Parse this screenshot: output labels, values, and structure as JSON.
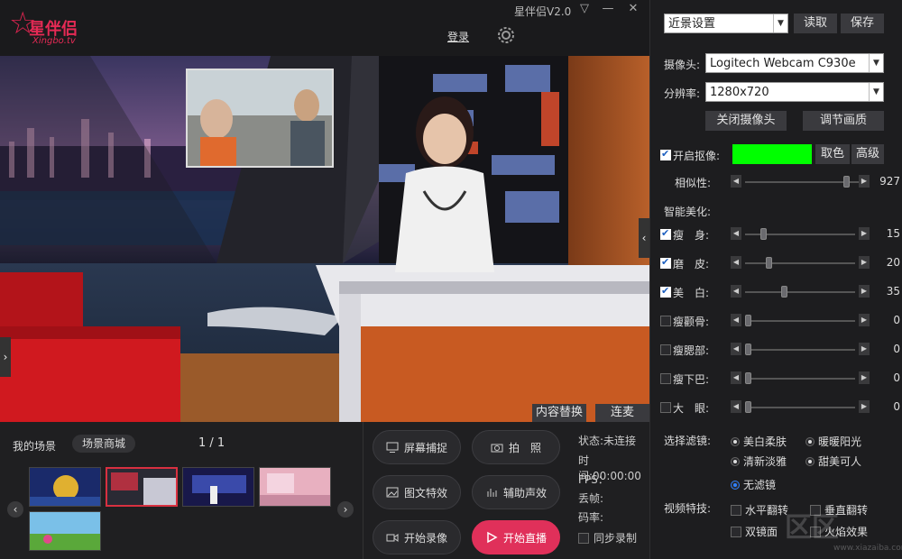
{
  "app": {
    "title": "星伴侣V2.0",
    "logo_text": "星伴侣",
    "logo_sub": "Xingbo.tv",
    "login": "登录"
  },
  "window": {
    "minimize": "▽",
    "maximize": "—",
    "close": "✕"
  },
  "preview": {
    "content_replace": "内容替换",
    "co_host": "连麦"
  },
  "scenes": {
    "my_scenes": "我的场景",
    "scene_mall": "场景商城",
    "page": "1 / 1"
  },
  "actions": {
    "screen_capture": "屏幕捕捉",
    "photo": "拍　照",
    "graphic_fx": "图文特效",
    "aux_sound": "辅助声效",
    "start_record": "开始录像",
    "start_live": "开始直播"
  },
  "status": {
    "state": "状态:未连接",
    "time": "时间:00:00:00",
    "fps": "FPS：",
    "drop": "丢帧:",
    "bitrate": "码率:",
    "sync_record": "同步录制"
  },
  "panel": {
    "preset": "近景设置",
    "read": "读取",
    "save": "保存",
    "camera_label": "摄像头:",
    "camera": "Logitech Webcam C930e",
    "resolution_label": "分辨率:",
    "resolution": "1280x720",
    "close_camera": "关闭摄像头",
    "adjust_image": "调节画质",
    "keying": "开启抠像:",
    "pick_color": "取色",
    "advanced": "高级",
    "key_color": "#00ff00",
    "similarity": {
      "label": "相似性:",
      "value": 927,
      "fraction": 0.92
    },
    "beauty_title": "智能美化:",
    "beauty": [
      {
        "label": "瘦　身:",
        "checked": true,
        "value": "15",
        "fraction": 0.15
      },
      {
        "label": "磨　皮:",
        "checked": true,
        "value": "20",
        "fraction": 0.2
      },
      {
        "label": "美　白:",
        "checked": true,
        "value": "35",
        "fraction": 0.35
      },
      {
        "label": "瘦颧骨:",
        "checked": false,
        "value": "0",
        "fraction": 0
      },
      {
        "label": "瘦腮部:",
        "checked": false,
        "value": "0",
        "fraction": 0
      },
      {
        "label": "瘦下巴:",
        "checked": false,
        "value": "0",
        "fraction": 0
      },
      {
        "label": "大　眼:",
        "checked": false,
        "value": "0",
        "fraction": 0
      }
    ],
    "filter_title": "选择滤镜:",
    "filters": [
      "美白柔肤",
      "暖暖阳光",
      "清新淡雅",
      "甜美可人",
      "无滤镜"
    ],
    "filter_selected": "无滤镜",
    "effects_title": "视频特技:",
    "effects": [
      "水平翻转",
      "垂直翻转",
      "双镜面",
      "火焰效果"
    ]
  },
  "watermark": {
    "text": "区区",
    "sub": "www.xiazaiba.com"
  }
}
